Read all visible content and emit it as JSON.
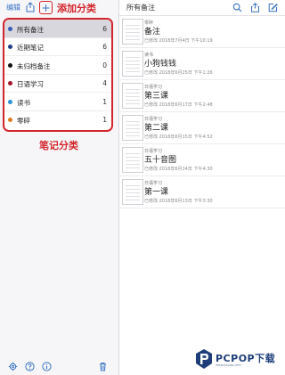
{
  "sidebar": {
    "edit_label": "编辑",
    "callout_add": "添加分类",
    "callout_categories": "笔记分类",
    "categories": [
      {
        "label": "所有备注",
        "count": "6",
        "color": "#3a5bb8"
      },
      {
        "label": "近期笔记",
        "count": "6",
        "color": "#1f3b8a"
      },
      {
        "label": "未归档备注",
        "count": "0",
        "color": "#111111"
      },
      {
        "label": "日语学习",
        "count": "4",
        "color": "#a0182a"
      },
      {
        "label": "读书",
        "count": "1",
        "color": "#2f8fd6"
      },
      {
        "label": "零碎",
        "count": "1",
        "color": "#e07a1f"
      }
    ]
  },
  "main": {
    "title": "所有备注",
    "notes": [
      {
        "category": "零碎",
        "title": "备注",
        "date": "已修改 2018年7月4日 下午10:19"
      },
      {
        "category": "读书",
        "title": "小狗钱钱",
        "date": "已修改 2018年6月25日 下午1:26"
      },
      {
        "category": "日语学习",
        "title": "第三课",
        "date": "已修改 2018年6月17日 下午2:48"
      },
      {
        "category": "日语学习",
        "title": "第二课",
        "date": "已修改 2018年6月15日 下午4:52"
      },
      {
        "category": "日语学习",
        "title": "五十音图",
        "date": "已修改 2018年6月14日 下午4:30"
      },
      {
        "category": "日语学习",
        "title": "第一课",
        "date": "已修改 2018年6月13日 下午3:30"
      }
    ]
  },
  "watermark": {
    "text": "PCPOP下载",
    "sub": "www.pcpop.com"
  },
  "colors": {
    "accent": "#3a73c4",
    "annotation": "#d3262c"
  }
}
